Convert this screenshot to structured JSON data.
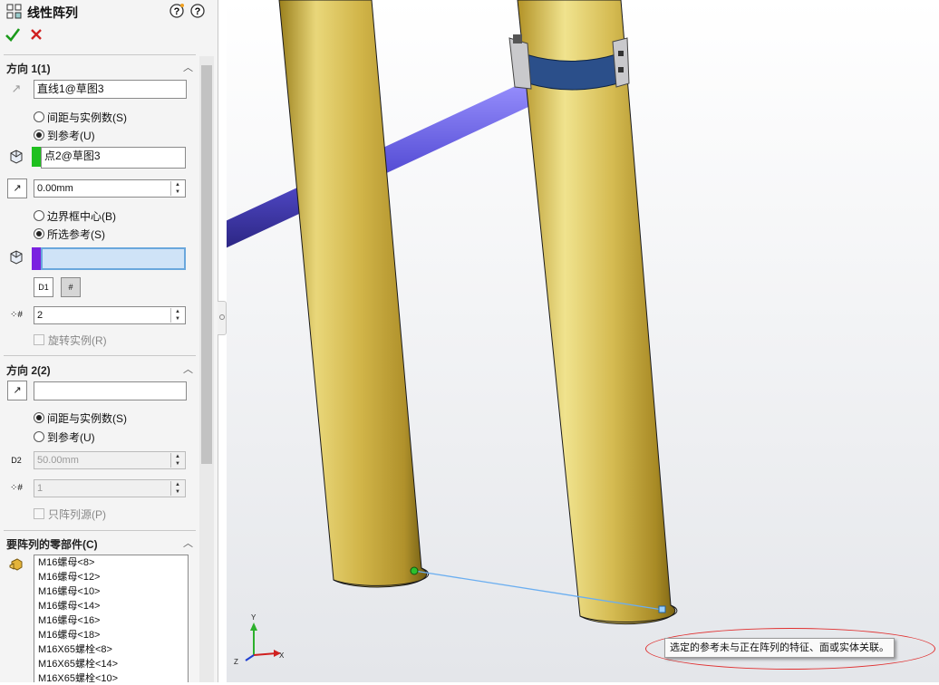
{
  "panel": {
    "title": "线性阵列",
    "ok_icon": "checkmark-icon",
    "cancel_icon": "x-icon",
    "help_icons": [
      "what's-wrong-icon",
      "help-icon"
    ],
    "direction1": {
      "header": "方向 1(1)",
      "direction_ref": "直线1@草图3",
      "radio_spacing": "间距与实例数(S)",
      "radio_upto": "到参考(U)",
      "reference_vertex": "点2@草图3",
      "offset": "0.00mm",
      "radio_bbox_center": "边界框中心(B)",
      "radio_selected_ref": "所选参考(S)",
      "ref_field": "",
      "btn_spacing_icon": "D1",
      "btn_instances_icon": "#",
      "instances": "2",
      "rotate_instances": "旋转实例(R)"
    },
    "direction2": {
      "header": "方向 2(2)",
      "direction_ref": "",
      "radio_spacing": "间距与实例数(S)",
      "radio_upto": "到参考(U)",
      "spacing": "50.00mm",
      "spacing_icon": "D2",
      "instances": "1",
      "pattern_seed_only": "只阵列源(P)"
    },
    "components": {
      "header": "要阵列的零部件(C)",
      "items": [
        "M16螺母<8>",
        "M16螺母<12>",
        "M16螺母<10>",
        "M16螺母<14>",
        "M16螺母<16>",
        "M16螺母<18>",
        "M16X65螺栓<8>",
        "M16X65螺栓<14>",
        "M16X65螺栓<10>"
      ]
    }
  },
  "viewport": {
    "tooltip": "选定的参考未与正在阵列的特征、面或实体关联。",
    "triad_labels": {
      "x": "X",
      "y": "Y",
      "z": "Z"
    }
  },
  "colors": {
    "pipe_gold": "#c9ad3c",
    "rod_blue": "#5a52d8",
    "clamp_blue": "#2b4f8a",
    "swatch_green": "#1fc01f",
    "swatch_purple": "#7a22e0",
    "tooltip_ring": "#e03030"
  }
}
